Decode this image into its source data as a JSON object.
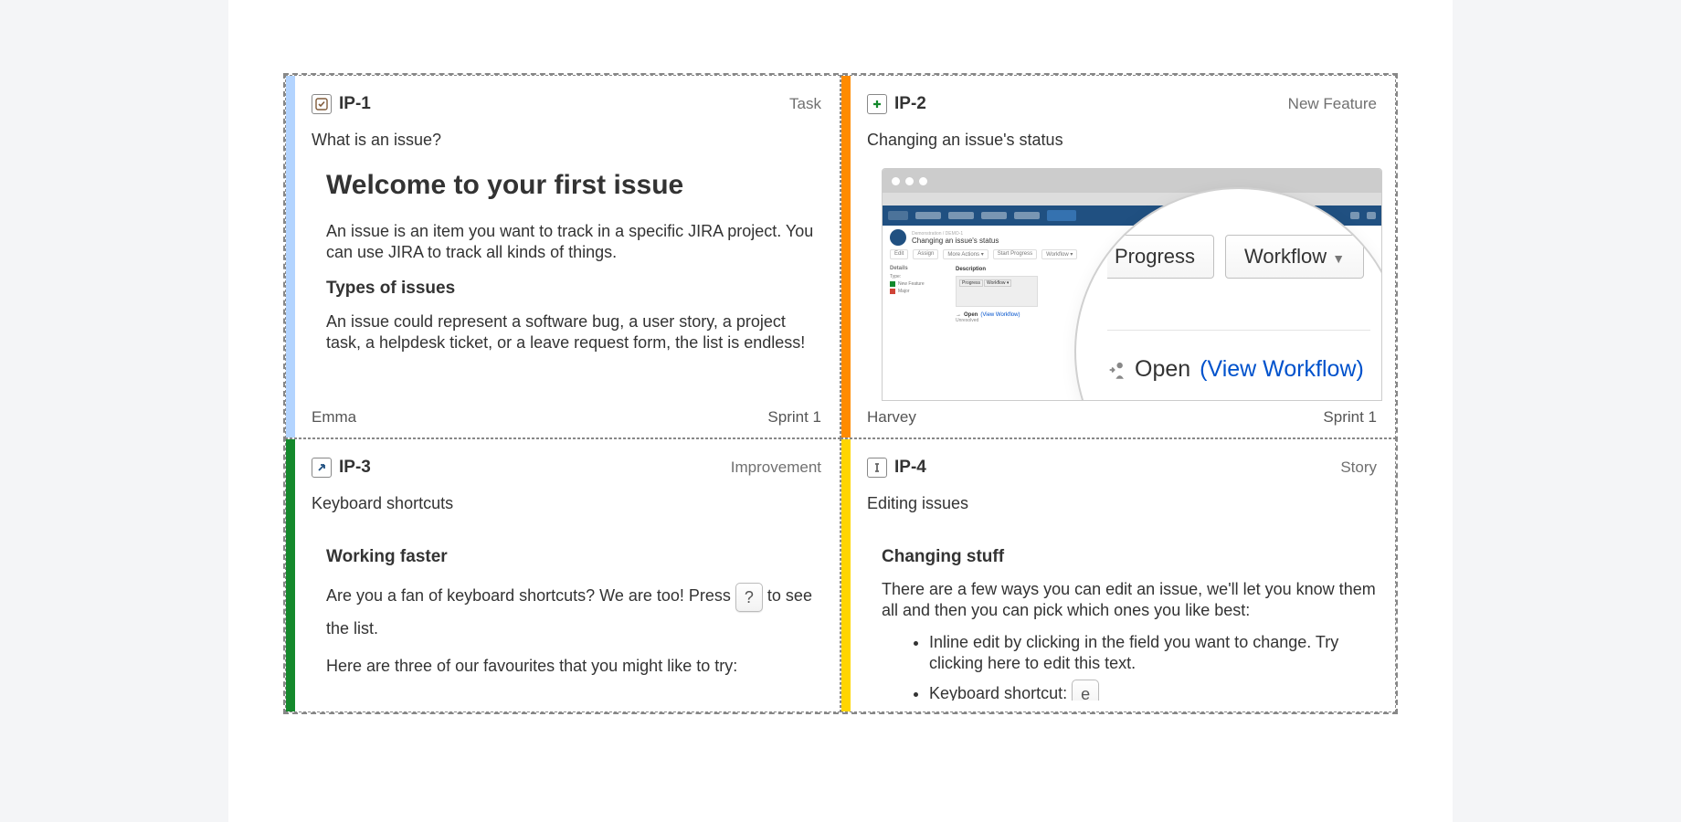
{
  "cards": [
    {
      "key": "IP-1",
      "type": "Task",
      "title": "What is an issue?",
      "heading": "Welcome to your first issue",
      "p1": "An issue is an item you want to track in a specific JIRA project. You can use JIRA to track all kinds of things.",
      "sub": "Types of issues",
      "p2": "An issue could represent a software bug, a user story, a project task, a helpdesk ticket, or a leave request form, the list is endless!",
      "assignee": "Emma",
      "sprint": "Sprint 1",
      "stripe": "#b3d4ff"
    },
    {
      "key": "IP-2",
      "type": "New Feature",
      "title": "Changing an issue's status",
      "assignee": "Harvey",
      "sprint": "Sprint 1",
      "stripe": "#ff8b00",
      "mock": {
        "crumb_title": "Changing an issue's status",
        "btn_progress": "Progress",
        "btn_workflow": "Workflow",
        "status_label": "Open",
        "status_link": "(View Workflow)",
        "mini_open": "Open",
        "mini_view": "(View Workflow)"
      }
    },
    {
      "key": "IP-3",
      "type": "Improvement",
      "title": "Keyboard shortcuts",
      "heading": "Working faster",
      "p1a": "Are you a fan of keyboard shortcuts? We are too! Press ",
      "key1": "?",
      "p1b": " to see the list.",
      "p2": "Here are three of our favourites that you might like to try:",
      "stripe": "#14892c"
    },
    {
      "key": "IP-4",
      "type": "Story",
      "title": "Editing issues",
      "heading": "Changing stuff",
      "p1": "There are a few ways you can edit an issue, we'll let you know them all and then you can pick which ones you like best:",
      "li1": "Inline edit by clicking in the field you want to change. Try clicking here to edit this text.",
      "li2a": "Keyboard shortcut: ",
      "li2_key": "e",
      "stripe": "#ffd500"
    }
  ]
}
